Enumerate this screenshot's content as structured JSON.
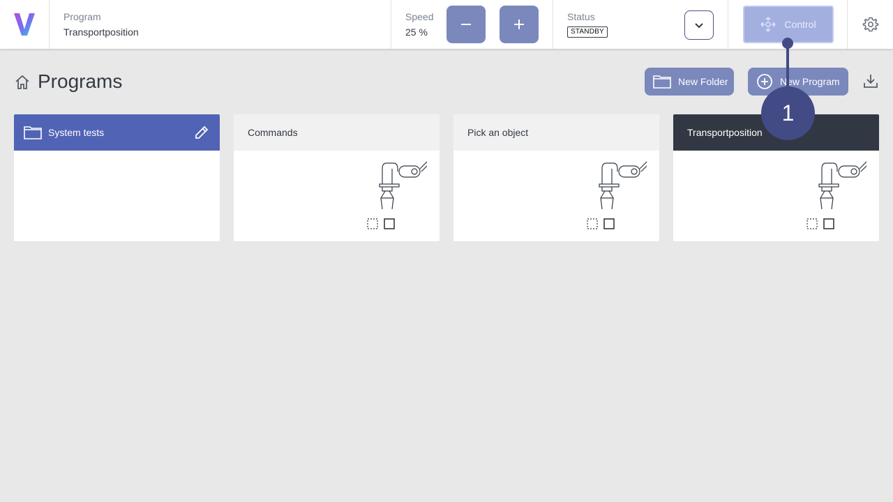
{
  "header": {
    "program_label": "Program",
    "program_value": "Transportposition",
    "speed_label": "Speed",
    "speed_value": "25 %",
    "status_label": "Status",
    "status_badge": "STANDBY",
    "control_label": "Control"
  },
  "page": {
    "title": "Programs",
    "new_folder_label": "New Folder",
    "new_program_label": "New Program"
  },
  "cards": [
    {
      "name": "System tests",
      "type": "folder"
    },
    {
      "name": "Commands",
      "type": "program"
    },
    {
      "name": "Pick an object",
      "type": "program"
    },
    {
      "name": "Transportposition",
      "type": "program",
      "selected": true
    }
  ],
  "annotation": {
    "number": "1"
  },
  "colors": {
    "accent": "#7a88bc",
    "folder_card": "#5163b5",
    "selected_card": "#313843",
    "annotation": "#424b85",
    "background": "#e8e8e8"
  },
  "icons": [
    "logo-icon",
    "minus-icon",
    "plus-icon",
    "chevron-down-icon",
    "move-icon",
    "gear-icon",
    "home-icon",
    "folder-icon",
    "plus-circle-icon",
    "download-icon",
    "pencil-icon",
    "robot-arm-icon"
  ]
}
